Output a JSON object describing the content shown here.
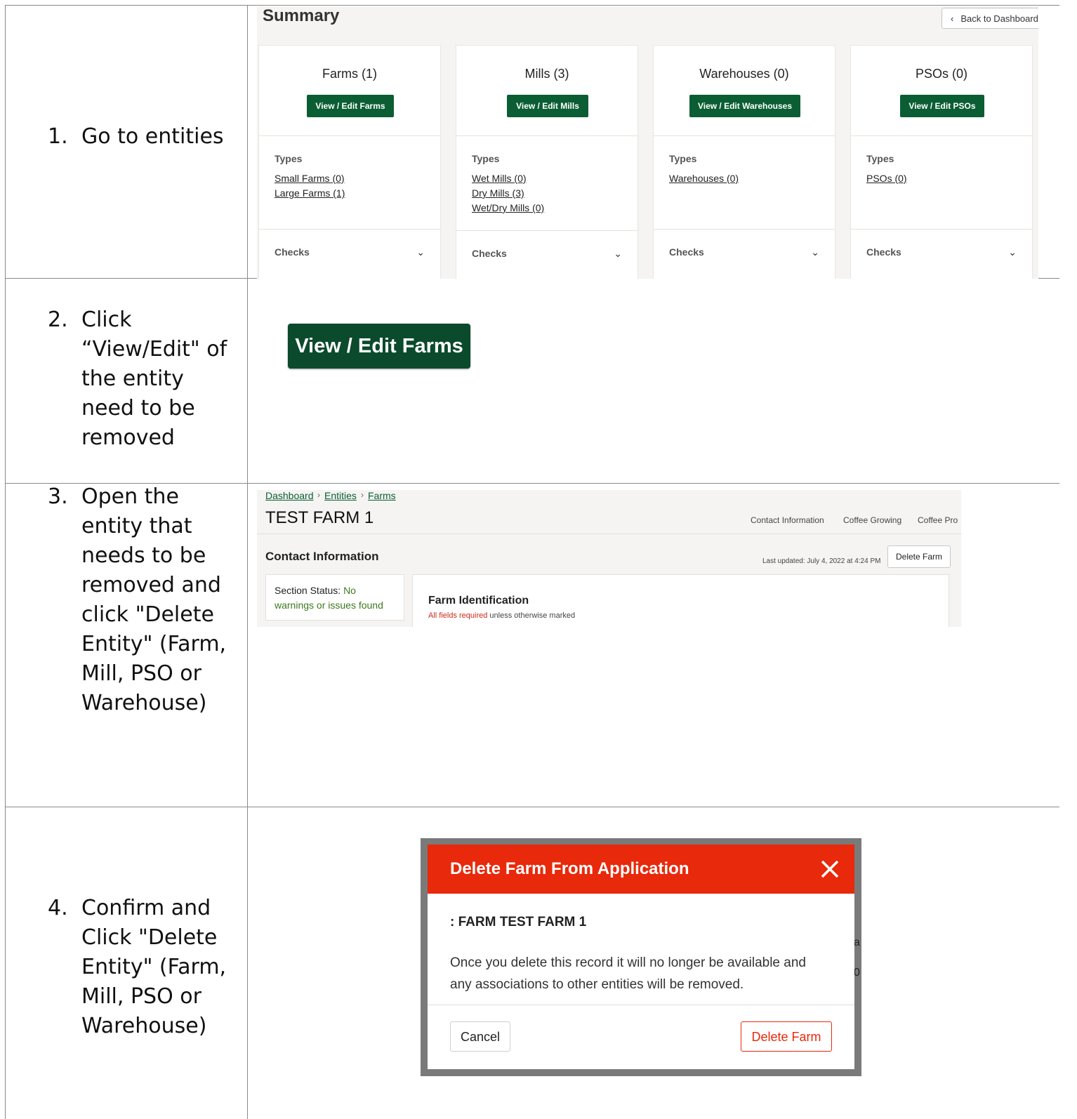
{
  "steps": [
    {
      "num": "1.",
      "text": "Go to entities"
    },
    {
      "num": "2.",
      "text": "Click “View/Edit\" of the entity need to be removed"
    },
    {
      "num": "3.",
      "text": "Open the entity that needs to be removed and click \"Delete Entity\" (Farm, Mill, PSO or Warehouse)"
    },
    {
      "num": "4.",
      "text": "Confirm and Click \"Delete Entity\" (Farm, Mill, PSO or Warehouse)"
    }
  ],
  "summary": {
    "title": "Summary",
    "back_label": "Back to Dashboard",
    "cards": [
      {
        "title": "Farms (1)",
        "button": "View / Edit Farms",
        "types_label": "Types",
        "links": [
          "Small Farms (0)",
          "Large Farms (1)"
        ],
        "checks": "Checks"
      },
      {
        "title": "Mills (3)",
        "button": "View / Edit Mills",
        "types_label": "Types",
        "links": [
          "Wet Mills (0)",
          "Dry Mills (3)",
          "Wet/Dry Mills (0)"
        ],
        "checks": "Checks"
      },
      {
        "title": "Warehouses (0)",
        "button": "View / Edit Warehouses",
        "types_label": "Types",
        "links": [
          "Warehouses (0)"
        ],
        "checks": "Checks"
      },
      {
        "title": "PSOs (0)",
        "button": "View / Edit PSOs",
        "types_label": "Types",
        "links": [
          "PSOs (0)"
        ],
        "checks": "Checks"
      }
    ]
  },
  "step2": {
    "button": "View / Edit Farms"
  },
  "farm": {
    "breadcrumb": [
      "Dashboard",
      "Entities",
      "Farms"
    ],
    "title": "TEST FARM 1",
    "nav": [
      "Contact Information",
      "Coffee Growing",
      "Coffee Pro"
    ],
    "section": "Contact Information",
    "last_updated": "Last updated: July 4, 2022 at 4:24 PM",
    "delete_button": "Delete Farm",
    "status_label": "Section Status:",
    "status_value": "No warnings or issues found",
    "fid_title": "Farm Identification",
    "fid_required": "All fields required",
    "fid_note": " unless otherwise marked"
  },
  "modal": {
    "title": "Delete Farm From Application",
    "record": ": FARM TEST FARM 1",
    "message": "Once you delete this record it will no longer be available and any associations to other entities will be removed.",
    "cancel": "Cancel",
    "confirm": "Delete Farm",
    "bg_peek": [
      "a",
      "0"
    ]
  },
  "colors": {
    "brand_green": "#0b5e33",
    "danger": "#e8290b"
  }
}
